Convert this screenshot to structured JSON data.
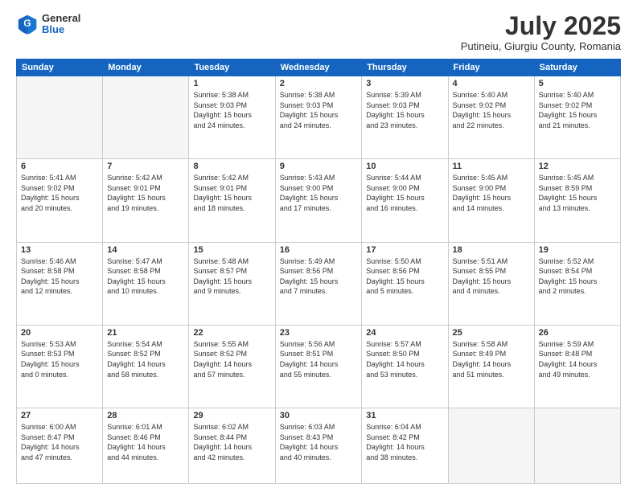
{
  "header": {
    "logo_general": "General",
    "logo_blue": "Blue",
    "month_title": "July 2025",
    "subtitle": "Putineiu, Giurgiu County, Romania"
  },
  "weekdays": [
    "Sunday",
    "Monday",
    "Tuesday",
    "Wednesday",
    "Thursday",
    "Friday",
    "Saturday"
  ],
  "weeks": [
    [
      {
        "day": "",
        "info": ""
      },
      {
        "day": "",
        "info": ""
      },
      {
        "day": "1",
        "info": "Sunrise: 5:38 AM\nSunset: 9:03 PM\nDaylight: 15 hours\nand 24 minutes."
      },
      {
        "day": "2",
        "info": "Sunrise: 5:38 AM\nSunset: 9:03 PM\nDaylight: 15 hours\nand 24 minutes."
      },
      {
        "day": "3",
        "info": "Sunrise: 5:39 AM\nSunset: 9:03 PM\nDaylight: 15 hours\nand 23 minutes."
      },
      {
        "day": "4",
        "info": "Sunrise: 5:40 AM\nSunset: 9:02 PM\nDaylight: 15 hours\nand 22 minutes."
      },
      {
        "day": "5",
        "info": "Sunrise: 5:40 AM\nSunset: 9:02 PM\nDaylight: 15 hours\nand 21 minutes."
      }
    ],
    [
      {
        "day": "6",
        "info": "Sunrise: 5:41 AM\nSunset: 9:02 PM\nDaylight: 15 hours\nand 20 minutes."
      },
      {
        "day": "7",
        "info": "Sunrise: 5:42 AM\nSunset: 9:01 PM\nDaylight: 15 hours\nand 19 minutes."
      },
      {
        "day": "8",
        "info": "Sunrise: 5:42 AM\nSunset: 9:01 PM\nDaylight: 15 hours\nand 18 minutes."
      },
      {
        "day": "9",
        "info": "Sunrise: 5:43 AM\nSunset: 9:00 PM\nDaylight: 15 hours\nand 17 minutes."
      },
      {
        "day": "10",
        "info": "Sunrise: 5:44 AM\nSunset: 9:00 PM\nDaylight: 15 hours\nand 16 minutes."
      },
      {
        "day": "11",
        "info": "Sunrise: 5:45 AM\nSunset: 9:00 PM\nDaylight: 15 hours\nand 14 minutes."
      },
      {
        "day": "12",
        "info": "Sunrise: 5:45 AM\nSunset: 8:59 PM\nDaylight: 15 hours\nand 13 minutes."
      }
    ],
    [
      {
        "day": "13",
        "info": "Sunrise: 5:46 AM\nSunset: 8:58 PM\nDaylight: 15 hours\nand 12 minutes."
      },
      {
        "day": "14",
        "info": "Sunrise: 5:47 AM\nSunset: 8:58 PM\nDaylight: 15 hours\nand 10 minutes."
      },
      {
        "day": "15",
        "info": "Sunrise: 5:48 AM\nSunset: 8:57 PM\nDaylight: 15 hours\nand 9 minutes."
      },
      {
        "day": "16",
        "info": "Sunrise: 5:49 AM\nSunset: 8:56 PM\nDaylight: 15 hours\nand 7 minutes."
      },
      {
        "day": "17",
        "info": "Sunrise: 5:50 AM\nSunset: 8:56 PM\nDaylight: 15 hours\nand 5 minutes."
      },
      {
        "day": "18",
        "info": "Sunrise: 5:51 AM\nSunset: 8:55 PM\nDaylight: 15 hours\nand 4 minutes."
      },
      {
        "day": "19",
        "info": "Sunrise: 5:52 AM\nSunset: 8:54 PM\nDaylight: 15 hours\nand 2 minutes."
      }
    ],
    [
      {
        "day": "20",
        "info": "Sunrise: 5:53 AM\nSunset: 8:53 PM\nDaylight: 15 hours\nand 0 minutes."
      },
      {
        "day": "21",
        "info": "Sunrise: 5:54 AM\nSunset: 8:52 PM\nDaylight: 14 hours\nand 58 minutes."
      },
      {
        "day": "22",
        "info": "Sunrise: 5:55 AM\nSunset: 8:52 PM\nDaylight: 14 hours\nand 57 minutes."
      },
      {
        "day": "23",
        "info": "Sunrise: 5:56 AM\nSunset: 8:51 PM\nDaylight: 14 hours\nand 55 minutes."
      },
      {
        "day": "24",
        "info": "Sunrise: 5:57 AM\nSunset: 8:50 PM\nDaylight: 14 hours\nand 53 minutes."
      },
      {
        "day": "25",
        "info": "Sunrise: 5:58 AM\nSunset: 8:49 PM\nDaylight: 14 hours\nand 51 minutes."
      },
      {
        "day": "26",
        "info": "Sunrise: 5:59 AM\nSunset: 8:48 PM\nDaylight: 14 hours\nand 49 minutes."
      }
    ],
    [
      {
        "day": "27",
        "info": "Sunrise: 6:00 AM\nSunset: 8:47 PM\nDaylight: 14 hours\nand 47 minutes."
      },
      {
        "day": "28",
        "info": "Sunrise: 6:01 AM\nSunset: 8:46 PM\nDaylight: 14 hours\nand 44 minutes."
      },
      {
        "day": "29",
        "info": "Sunrise: 6:02 AM\nSunset: 8:44 PM\nDaylight: 14 hours\nand 42 minutes."
      },
      {
        "day": "30",
        "info": "Sunrise: 6:03 AM\nSunset: 8:43 PM\nDaylight: 14 hours\nand 40 minutes."
      },
      {
        "day": "31",
        "info": "Sunrise: 6:04 AM\nSunset: 8:42 PM\nDaylight: 14 hours\nand 38 minutes."
      },
      {
        "day": "",
        "info": ""
      },
      {
        "day": "",
        "info": ""
      }
    ]
  ]
}
